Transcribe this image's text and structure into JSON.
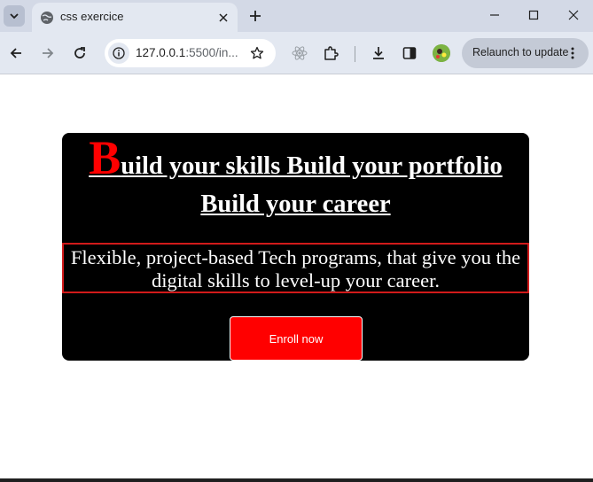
{
  "browser": {
    "tab": {
      "title": "css exercice"
    },
    "address_bar": {
      "url_host": "127.0.0.1",
      "url_rest": ":5500/in..."
    },
    "relaunch_label": "Relaunch to update",
    "icons": [
      "tab-search-icon",
      "globe-icon",
      "close-icon",
      "plus-icon",
      "minimize-icon",
      "maximize-icon",
      "close-window-icon",
      "back-arrow-icon",
      "forward-arrow-icon",
      "reload-icon",
      "info-icon",
      "star-icon",
      "react-devtools-icon",
      "extensions-puzzle-icon",
      "download-icon",
      "side-panel-icon",
      "profile-avatar-icon",
      "kebab-menu-icon"
    ]
  },
  "hero": {
    "heading_first_letter": "B",
    "heading_rest_line1": "uild your skills Build your portfolio",
    "heading_line2": "Build your career",
    "subtitle": "Flexible, project-based Tech programs, that give you the digital skills to level-up your career.",
    "button_label": "Enroll now"
  },
  "colors": {
    "hero_background": "#000000",
    "accent_red": "#ff0000",
    "subtitle_border": "#d11a1a",
    "text": "#ffffff"
  }
}
